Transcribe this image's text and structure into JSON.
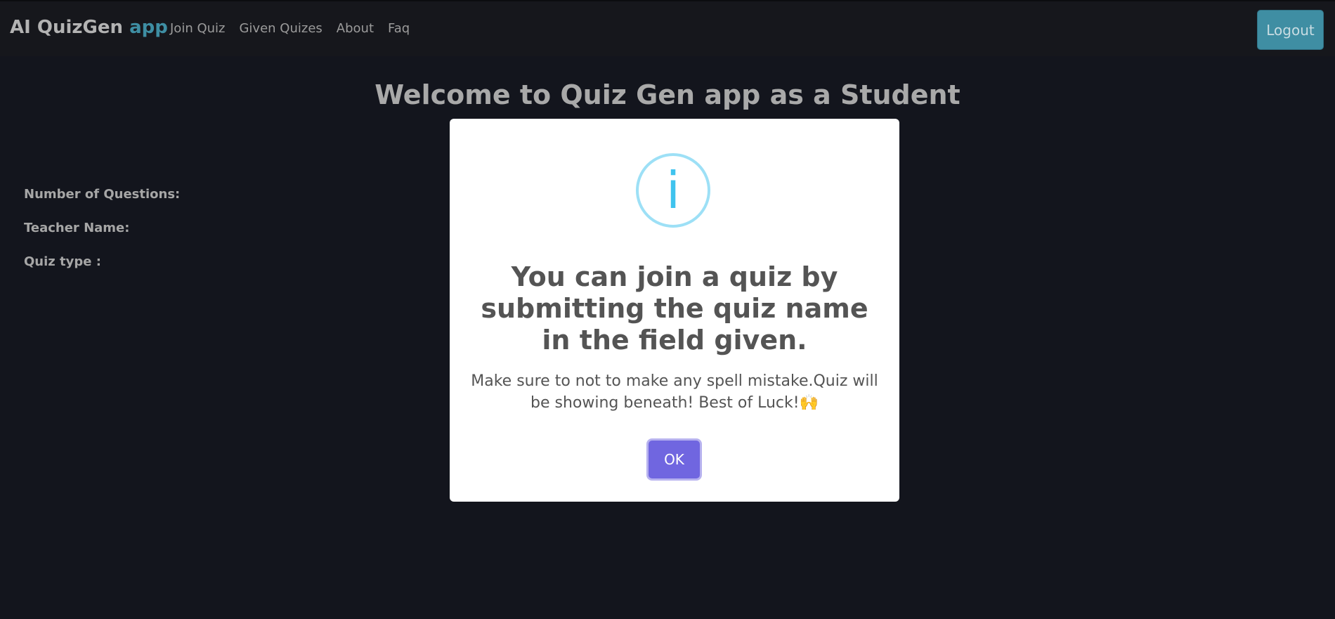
{
  "navbar": {
    "brand_main": "AI QuizGen",
    "brand_accent": "app",
    "links": [
      "Join Quiz",
      "Given Quizes",
      "About",
      "Faq"
    ],
    "logout_label": "Logout"
  },
  "main": {
    "title": "Welcome to Quiz Gen app as a Student",
    "info_labels": [
      "Number of Questions:",
      "Teacher Name:",
      "Quiz type :"
    ]
  },
  "modal": {
    "icon": "info-icon",
    "icon_glyph": "i",
    "title": "You can join a quiz by submitting the quiz name in the field given.",
    "text": "Make sure to not to make any spell mistake.Quiz will be showing beneath! Best of Luck!🙌",
    "ok_label": "OK"
  },
  "colors": {
    "background": "#13151d",
    "navbar": "#16171c",
    "accent": "#3e8ea3",
    "logout_button": "#3f8ea3",
    "modal_button": "#7066e0",
    "info_icon": "#3fc3ee"
  }
}
